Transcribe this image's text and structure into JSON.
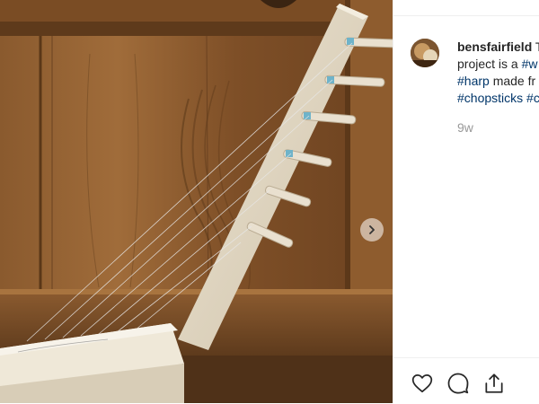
{
  "post": {
    "username": "bensfairfield",
    "caption_lines": [
      {
        "text": " T",
        "tag": ""
      },
      {
        "text": "project is a ",
        "tag": "#w"
      },
      {
        "text": "",
        "tag": "#harp",
        "after": " made fr"
      },
      {
        "text": "",
        "tag": "#chopsticks",
        "after": " ",
        "tag2": "#c"
      }
    ],
    "time_ago": "9w"
  },
  "icons": {
    "next": "chevron-right-icon",
    "like": "heart-icon",
    "comment": "comment-icon",
    "share": "share-icon"
  },
  "colors": {
    "hashtag": "#003569",
    "muted": "#999999",
    "text": "#262626"
  }
}
